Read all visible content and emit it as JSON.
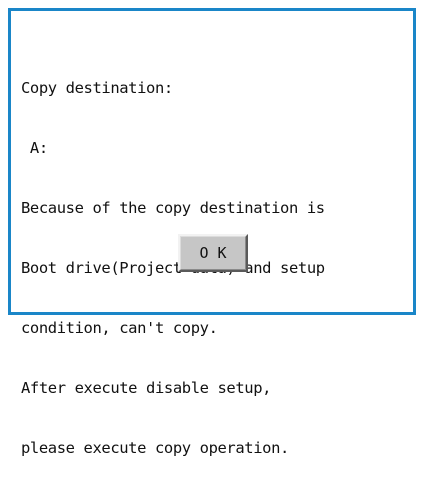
{
  "dialog": {
    "lines": [
      "Copy destination:",
      " A:",
      "Because of the copy destination is",
      "Boot drive(Project data) and setup",
      "condition, can't copy.",
      "After execute disable setup,",
      "please execute copy operation."
    ],
    "ok_label": "O K"
  },
  "colors": {
    "border": "#1a86c8",
    "button_face": "#c6c6c6"
  }
}
